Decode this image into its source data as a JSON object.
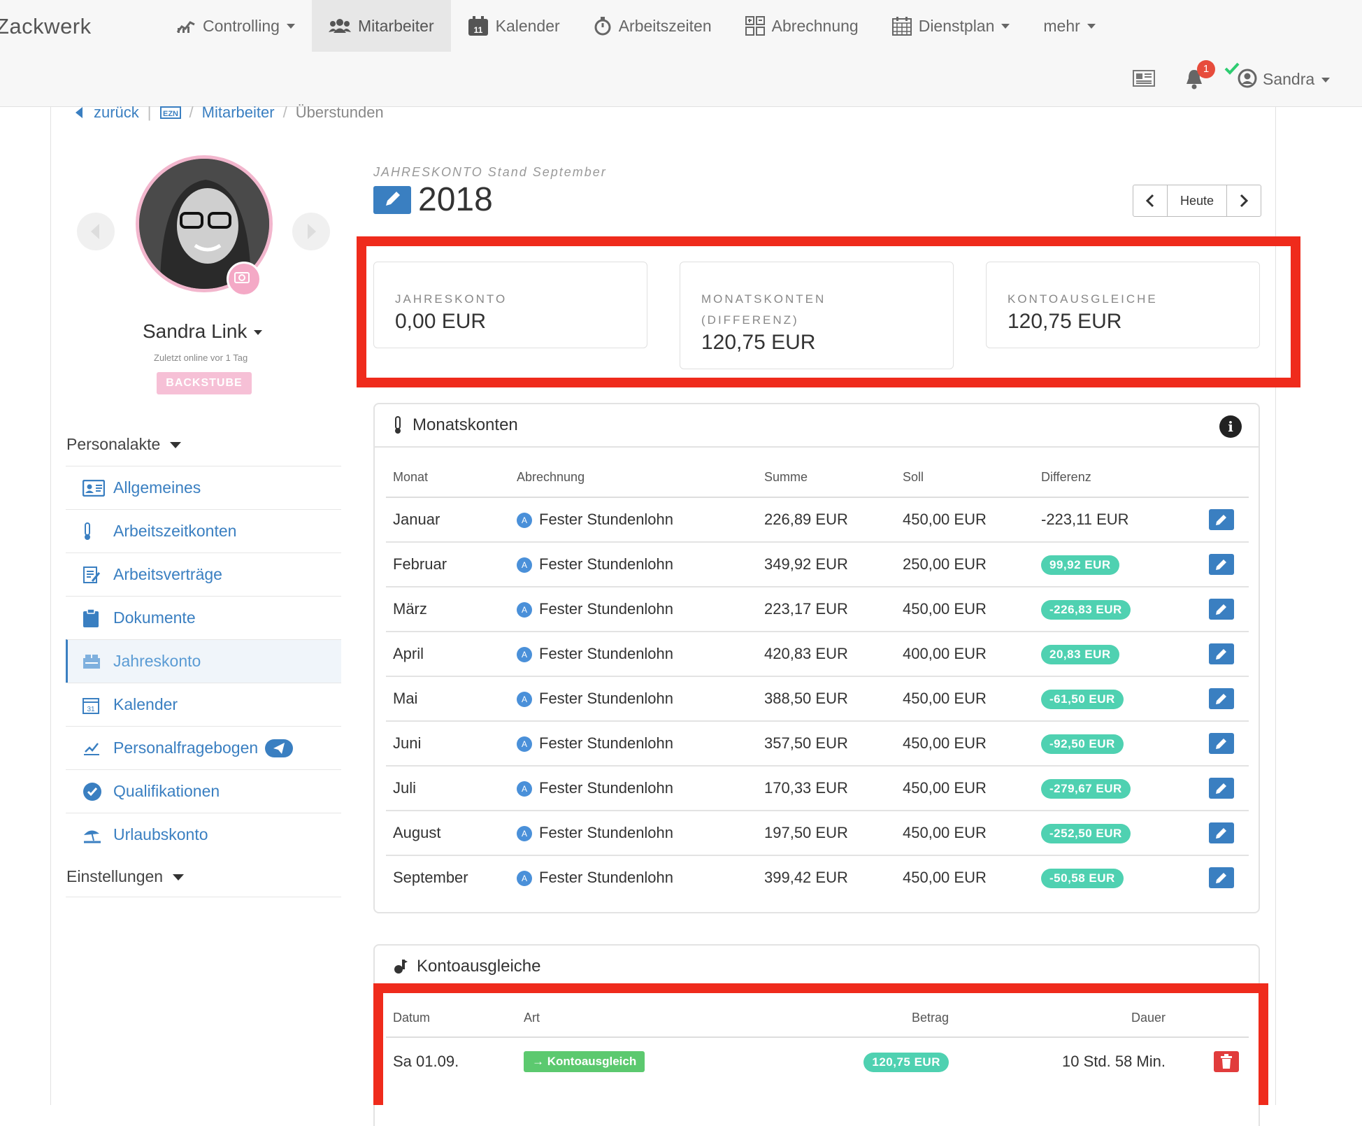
{
  "brand": "Zackwerk",
  "nav": [
    {
      "label": "Controlling",
      "icon": "chart-line-icon",
      "caret": true
    },
    {
      "label": "Mitarbeiter",
      "icon": "users-icon",
      "caret": false,
      "active": true
    },
    {
      "label": "Kalender",
      "icon": "calendar-icon",
      "caret": false
    },
    {
      "label": "Arbeitszeiten",
      "icon": "stopwatch-icon",
      "caret": false
    },
    {
      "label": "Abrechnung",
      "icon": "calculator-icon",
      "caret": false
    },
    {
      "label": "Dienstplan",
      "icon": "schedule-icon",
      "caret": true
    },
    {
      "label": "mehr",
      "icon": "",
      "caret": true
    }
  ],
  "topright": {
    "notifications": "1",
    "user": "Sandra"
  },
  "breadcrumb": {
    "back": "zurück",
    "items": [
      "Mitarbeiter",
      "Überstunden"
    ]
  },
  "profile": {
    "name": "Sandra Link",
    "last_seen": "Zuletzt online vor 1 Tag",
    "tag": "BACKSTUBE"
  },
  "sidebar": {
    "section1": "Personalakte",
    "section2": "Einstellungen",
    "items": [
      {
        "label": "Allgemeines",
        "icon": "id-card-icon"
      },
      {
        "label": "Arbeitszeitkonten",
        "icon": "thermometer-icon"
      },
      {
        "label": "Arbeitsverträge",
        "icon": "contract-icon"
      },
      {
        "label": "Dokumente",
        "icon": "clipboard-icon"
      },
      {
        "label": "Jahreskonto",
        "icon": "yearly-account-icon",
        "active": true
      },
      {
        "label": "Kalender",
        "icon": "calendar-icon"
      },
      {
        "label": "Personalfragebogen",
        "icon": "form-icon"
      },
      {
        "label": "Qualifikationen",
        "icon": "badge-check-icon"
      },
      {
        "label": "Urlaubskonto",
        "icon": "beach-icon"
      }
    ]
  },
  "header": {
    "caption": "JAHRESKONTO Stand September",
    "year": "2018",
    "today": "Heute"
  },
  "stats": [
    {
      "label": "JAHRESKONTO",
      "value": "0,00 EUR"
    },
    {
      "label": "MONATSKONTEN (DIFFERENZ)",
      "value": "120,75 EUR"
    },
    {
      "label": "KONTOAUSGLEICHE",
      "value": "120,75 EUR"
    }
  ],
  "monatskonten": {
    "title": "Monatskonten",
    "columns": [
      "Monat",
      "Abrechnung",
      "Summe",
      "Soll",
      "Differenz"
    ],
    "rows": [
      {
        "monat": "Januar",
        "abrechnung": "Fester Stundenlohn",
        "summe": "226,89 EUR",
        "soll": "450,00 EUR",
        "differenz": "-223,11 EUR",
        "badge": false
      },
      {
        "monat": "Februar",
        "abrechnung": "Fester Stundenlohn",
        "summe": "349,92 EUR",
        "soll": "250,00 EUR",
        "differenz": "99,92 EUR",
        "badge": true
      },
      {
        "monat": "März",
        "abrechnung": "Fester Stundenlohn",
        "summe": "223,17 EUR",
        "soll": "450,00 EUR",
        "differenz": "-226,83 EUR",
        "badge": true
      },
      {
        "monat": "April",
        "abrechnung": "Fester Stundenlohn",
        "summe": "420,83 EUR",
        "soll": "400,00 EUR",
        "differenz": "20,83 EUR",
        "badge": true
      },
      {
        "monat": "Mai",
        "abrechnung": "Fester Stundenlohn",
        "summe": "388,50 EUR",
        "soll": "450,00 EUR",
        "differenz": "-61,50 EUR",
        "badge": true
      },
      {
        "monat": "Juni",
        "abrechnung": "Fester Stundenlohn",
        "summe": "357,50 EUR",
        "soll": "450,00 EUR",
        "differenz": "-92,50 EUR",
        "badge": true
      },
      {
        "monat": "Juli",
        "abrechnung": "Fester Stundenlohn",
        "summe": "170,33 EUR",
        "soll": "450,00 EUR",
        "differenz": "-279,67 EUR",
        "badge": true
      },
      {
        "monat": "August",
        "abrechnung": "Fester Stundenlohn",
        "summe": "197,50 EUR",
        "soll": "450,00 EUR",
        "differenz": "-252,50 EUR",
        "badge": true
      },
      {
        "monat": "September",
        "abrechnung": "Fester Stundenlohn",
        "summe": "399,42 EUR",
        "soll": "450,00 EUR",
        "differenz": "-50,58 EUR",
        "badge": true
      }
    ]
  },
  "kontoausgleiche": {
    "title": "Kontoausgleiche",
    "columns": [
      "Datum",
      "Art",
      "Betrag",
      "Dauer"
    ],
    "rows": [
      {
        "datum": "Sa 01.09.",
        "art": "Kontoausgleich",
        "betrag": "120,75 EUR",
        "dauer": "10 Std. 58 Min."
      }
    ]
  },
  "colors": {
    "accent": "#3a7fc1",
    "success": "#4fd1b1",
    "highlight": "#ef2b1c",
    "pink": "#f6c0d6"
  }
}
